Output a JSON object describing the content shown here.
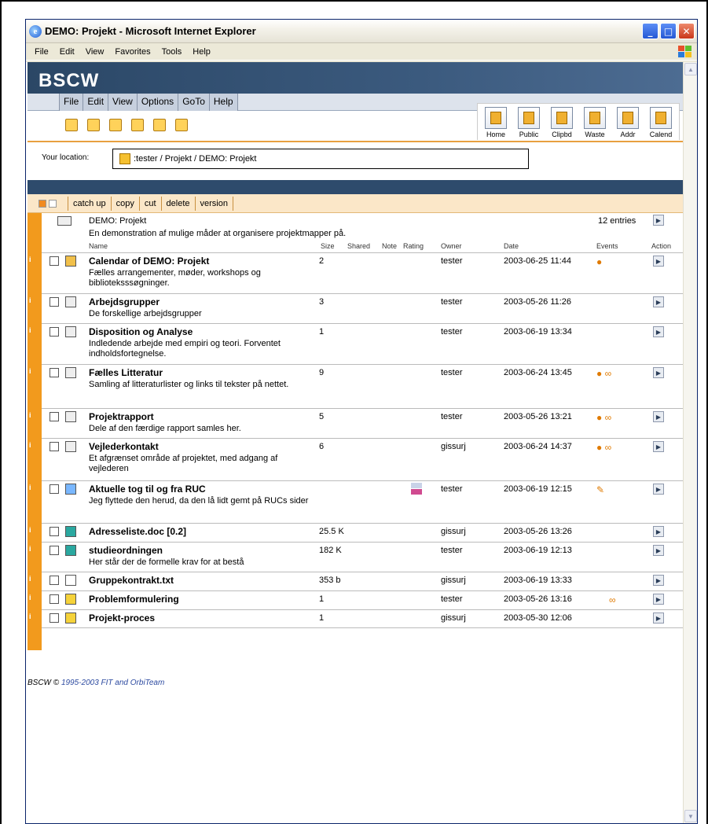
{
  "window": {
    "title": "DEMO: Projekt - Microsoft Internet Explorer"
  },
  "menu": [
    "File",
    "Edit",
    "View",
    "Favorites",
    "Tools",
    "Help"
  ],
  "app": {
    "logo": "BSCW",
    "nav": [
      "File",
      "Edit",
      "View",
      "Options",
      "GoTo",
      "Help"
    ],
    "big_buttons": [
      "Home",
      "Public",
      "Clipbd",
      "Waste",
      "Addr",
      "Calend"
    ],
    "location_label": "Your location:",
    "location_path": ":tester / Projekt / DEMO: Projekt"
  },
  "actions": [
    "catch up",
    "copy",
    "cut",
    "delete",
    "version"
  ],
  "folder": {
    "name": "DEMO: Projekt",
    "description": "En demonstration af mulige måder at organisere projektmapper på.",
    "entries": "12 entries"
  },
  "columns": {
    "name": "Name",
    "size": "Size",
    "shared": "Shared",
    "note": "Note",
    "rating": "Rating",
    "owner": "Owner",
    "date": "Date",
    "events": "Events",
    "action": "Action"
  },
  "rows": [
    {
      "name": "Calendar of DEMO: Projekt",
      "desc": "Fælles arrangementer, møder, workshops og biblioteksssøgninger.",
      "size": "2",
      "owner": "tester",
      "date": "2003-06-25 11:44",
      "events": "●",
      "icon": "calendar-icon"
    },
    {
      "name": "Arbejdsgrupper",
      "desc": "De forskellige arbejdsgrupper",
      "size": "3",
      "owner": "tester",
      "date": "2003-05-26 11:26",
      "events": "",
      "icon": "folder-icon"
    },
    {
      "name": "Disposition og Analyse",
      "desc": "Indledende arbejde med empiri og teori. Forventet indholdsfortegnelse.",
      "size": "1",
      "owner": "tester",
      "date": "2003-06-19 13:34",
      "events": "",
      "icon": "folder-icon"
    },
    {
      "name": "Fælles Litteratur",
      "desc": "Samling af litteraturlister og links til tekster på nettet.",
      "size": "9",
      "owner": "tester",
      "date": "2003-06-24 13:45",
      "events": "● ∞",
      "icon": "folder-icon"
    },
    {
      "name": "Projektrapport",
      "desc": "Dele af den færdige rapport samles her.",
      "size": "5",
      "owner": "tester",
      "date": "2003-05-26 13:21",
      "events": "● ∞",
      "icon": "folder-icon"
    },
    {
      "name": "Vejlederkontakt",
      "desc": "Et afgrænset område af projektet, med adgang af vejlederen",
      "size": "6",
      "owner": "gissurj",
      "date": "2003-06-24 14:37",
      "events": "● ∞",
      "icon": "folder-icon"
    },
    {
      "name": "Aktuelle tog til og fra RUC",
      "desc": "Jeg flyttede den herud, da den lå lidt gemt på RUCs sider",
      "size": "",
      "owner": "tester",
      "date": "2003-06-19 12:15",
      "events": "✎",
      "icon": "link-icon"
    },
    {
      "name": "Adresseliste.doc [0.2]",
      "desc": "",
      "size": "25.5 K",
      "owner": "gissurj",
      "date": "2003-05-26 13:26",
      "events": "",
      "icon": "document-icon"
    },
    {
      "name": "studieordningen",
      "desc": "Her står der de formelle krav for at bestå",
      "size": "182 K",
      "owner": "tester",
      "date": "2003-06-19 12:13",
      "events": "",
      "icon": "document-icon"
    },
    {
      "name": "Gruppekontrakt.txt",
      "desc": "",
      "size": "353 b",
      "owner": "gissurj",
      "date": "2003-06-19 13:33",
      "events": "",
      "icon": "text-file-icon"
    },
    {
      "name": "Problemformulering",
      "desc": "",
      "size": "1",
      "owner": "tester",
      "date": "2003-05-26 13:16",
      "events": "∞",
      "icon": "discussion-icon"
    },
    {
      "name": "Projekt-proces",
      "desc": "",
      "size": "1",
      "owner": "gissurj",
      "date": "2003-05-30 12:06",
      "events": "",
      "icon": "discussion-icon"
    }
  ],
  "footer": {
    "prefix": "BSCW © ",
    "years": "1995-2003 FIT and OrbiTeam"
  }
}
